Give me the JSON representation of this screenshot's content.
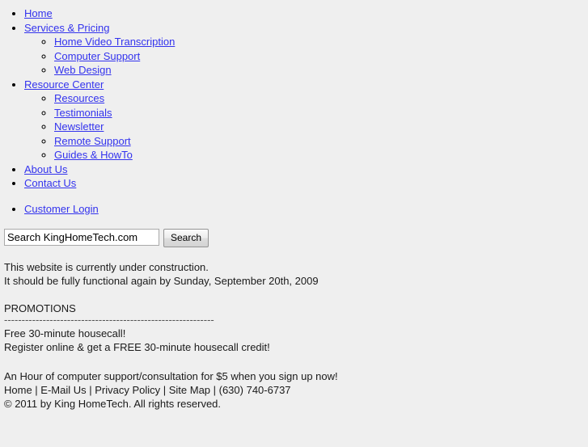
{
  "colors": {
    "background": "#efefef",
    "link": "#3333ee",
    "text": "#1a1a1a",
    "rule": "#555555"
  },
  "nav": {
    "primary": [
      {
        "label": "Home",
        "children": []
      },
      {
        "label": "Services & Pricing",
        "children": [
          {
            "label": "Home Video Transcription"
          },
          {
            "label": "Computer Support"
          },
          {
            "label": "Web Design"
          }
        ]
      },
      {
        "label": "Resource Center",
        "children": [
          {
            "label": "Resources"
          },
          {
            "label": "Testimonials"
          },
          {
            "label": "Newsletter"
          },
          {
            "label": "Remote Support"
          },
          {
            "label": "Guides & HowTo"
          }
        ]
      },
      {
        "label": "About Us",
        "children": []
      },
      {
        "label": "Contact Us",
        "children": []
      }
    ],
    "secondary": [
      {
        "label": "Customer Login"
      }
    ]
  },
  "search": {
    "value": "Search KingHomeTech.com",
    "placeholder": "Search KingHomeTech.com",
    "button_label": "Search"
  },
  "notice": {
    "line1": "This website is currently under construction.",
    "line2": "It should be fully functional again by Sunday, September 20th, 2009"
  },
  "promotions": {
    "heading": "PROMOTIONS",
    "divider": "------------------------------------------------------------",
    "line1": "Free 30-minute housecall!",
    "line2": "Register online & get a FREE 30-minute housecall credit!"
  },
  "offer": {
    "text": "An Hour of computer support/consultation for $5 when you sign up now!"
  },
  "footer": {
    "links_line": "Home | E-Mail Us | Privacy Policy | Site Map | (630) 740-6737",
    "copyright": "© 2011 by King HomeTech. All rights reserved."
  }
}
